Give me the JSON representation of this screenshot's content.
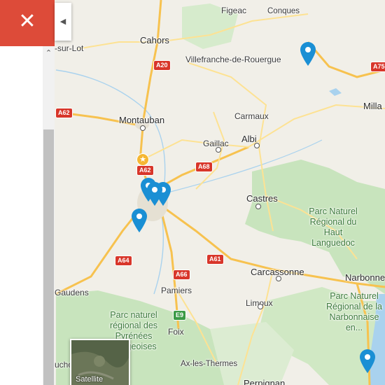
{
  "panel": {
    "close_icon": "close-x-icon",
    "collapse_icon": "triangle-left-icon"
  },
  "map": {
    "towns": {
      "figeac": "Figeac",
      "conques": "Conques",
      "cahors": "Cahors",
      "villefranche": "Villefranche-de-Rouergue",
      "surlot": "-sur-Lot",
      "montauban": "Montauban",
      "carmaux": "Carmaux",
      "gaillac": "Gaillac",
      "albi": "Albi",
      "millau": "Milla",
      "castres": "Castres",
      "carcassonne": "Carcassonne",
      "narbonne": "Narbonne",
      "pamiers": "Pamiers",
      "limoux": "Limoux",
      "foix": "Foix",
      "axlesthermes": "Ax-les-Thermes",
      "gaudens": "Gaudens",
      "uchon": "uchon",
      "perpignan": "Perpignan"
    },
    "parks": {
      "haut_languedoc": "Parc Naturel Régional du Haut Languedoc",
      "pyrenees": "Parc naturel régional des Pyrénées Ariégeoises",
      "narbonnaise": "Parc Naturel Régional de la Narbonnaise en..."
    },
    "roads": {
      "a20": "A20",
      "a75": "A75",
      "a62_w": "A62",
      "a62_c": "A62",
      "a68": "A68",
      "a64": "A64",
      "a66": "A66",
      "a61": "A61",
      "e9": "E9"
    },
    "satellite_label": "Satellite",
    "colors": {
      "pin": "#1a8fd4",
      "close": "#dd4b39",
      "park": "#c8e4bd"
    }
  }
}
